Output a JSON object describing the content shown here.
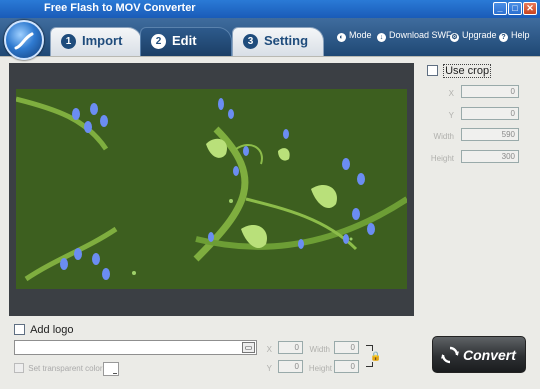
{
  "window": {
    "title": "Free Flash to MOV Converter",
    "minimize": "_",
    "maximize": "□",
    "close": "✕"
  },
  "tabs": [
    {
      "num": "1",
      "label": "Import"
    },
    {
      "num": "2",
      "label": "Edit",
      "active": true
    },
    {
      "num": "3",
      "label": "Setting"
    }
  ],
  "top_links": {
    "mode": "Mode",
    "download": "Download SWF",
    "upgrade": "Upgrade",
    "help": "Help",
    "mode_icon": "mode-icon",
    "download_icon": "download-icon",
    "upgrade_icon": "upgrade-icon",
    "help_icon": "help-icon"
  },
  "crop": {
    "use_crop_label": "Use crop",
    "x_label": "X",
    "x_value": "0",
    "y_label": "Y",
    "y_value": "0",
    "width_label": "Width",
    "width_value": "590",
    "height_label": "Height",
    "height_value": "300"
  },
  "logo": {
    "add_logo_label": "Add logo",
    "path_value": "",
    "browse_icon": "folder-icon",
    "transparent_label": "Set transparent color",
    "x_label": "X",
    "x_value": "0",
    "y_label": "Y",
    "y_value": "0",
    "width_label": "Width",
    "width_value": "0",
    "height_label": "Height",
    "height_value": "0",
    "lock_icon": "lock-icon"
  },
  "convert": {
    "label": "Convert",
    "icon": "convert-arrows-icon"
  },
  "colors": {
    "accent": "#1f4874",
    "canvas_bg": "#3d5f1f",
    "preview_bg": "#3b3f44"
  }
}
